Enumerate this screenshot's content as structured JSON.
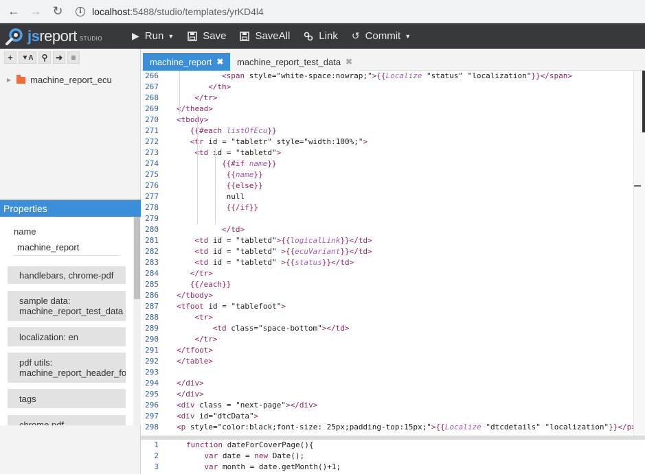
{
  "browser": {
    "url_host": "localhost",
    "url_path": ":5488/studio/templates/yrKD4l4"
  },
  "app": {
    "logo_js": "js",
    "logo_report": "report",
    "logo_studio": "STUDIO",
    "toolbar": {
      "run": "Run",
      "save": "Save",
      "save_all": "SaveAll",
      "link": "Link",
      "commit": "Commit"
    }
  },
  "tree": {
    "folder": "machine_report_ecu"
  },
  "properties": {
    "header": "Properties",
    "name_label": "name",
    "name_value": "machine_report",
    "buttons": [
      {
        "line1": "handlebars, chrome-pdf",
        "line2": ""
      },
      {
        "line1": "sample data:",
        "line2": "machine_report_test_data"
      },
      {
        "line1": "localization: en",
        "line2": ""
      },
      {
        "line1": "pdf utils:",
        "line2": "machine_report_header_footer"
      },
      {
        "line1": "tags",
        "line2": ""
      },
      {
        "line1": "chrome pdf",
        "line2": ""
      }
    ]
  },
  "tabs": [
    {
      "label": "machine_report",
      "active": true
    },
    {
      "label": "machine_report_test_data",
      "active": false
    }
  ],
  "editor_lines": [
    {
      "n": "266",
      "indent": 10,
      "tokens": [
        [
          "t-tag",
          "<span "
        ],
        [
          "t-attr",
          "style="
        ],
        [
          "t-str",
          "\"white-space:nowrap;\""
        ],
        [
          "t-tag",
          ">"
        ],
        [
          "t-hb",
          "{{"
        ],
        [
          "t-var",
          "Localize"
        ],
        [
          "t-js",
          " \"status\" \"localization\""
        ],
        [
          "t-hb",
          "}}"
        ],
        [
          "t-tag",
          "</span>"
        ]
      ]
    },
    {
      "n": "267",
      "indent": 7,
      "tokens": [
        [
          "t-tag",
          "</th>"
        ]
      ]
    },
    {
      "n": "268",
      "indent": 4,
      "tokens": [
        [
          "t-tag",
          "</tr>"
        ]
      ]
    },
    {
      "n": "269",
      "indent": 0,
      "tokens": [
        [
          "t-tag",
          "</thead>"
        ]
      ]
    },
    {
      "n": "270",
      "indent": 0,
      "tokens": [
        [
          "t-tag",
          "<tbody>"
        ]
      ]
    },
    {
      "n": "271",
      "indent": 3,
      "tokens": [
        [
          "t-hb",
          "{{#each "
        ],
        [
          "t-var",
          "listOfEcu"
        ],
        [
          "t-hb",
          "}}"
        ]
      ]
    },
    {
      "n": "272",
      "indent": 3,
      "tokens": [
        [
          "t-tag",
          "<tr "
        ],
        [
          "t-attr",
          "id = "
        ],
        [
          "t-str",
          "\"tabletr\""
        ],
        [
          "t-attr",
          " style="
        ],
        [
          "t-str",
          "\"width:100%;\""
        ],
        [
          "t-tag",
          ">"
        ]
      ]
    },
    {
      "n": "273",
      "indent": 4,
      "tokens": [
        [
          "t-tag",
          "<td "
        ],
        [
          "t-attr",
          "id = "
        ],
        [
          "t-str",
          "\"tabletd\""
        ],
        [
          "t-tag",
          ">"
        ]
      ]
    },
    {
      "n": "274",
      "indent": 10,
      "tokens": [
        [
          "t-hb",
          "{{#if "
        ],
        [
          "t-var",
          "name"
        ],
        [
          "t-hb",
          "}}"
        ]
      ]
    },
    {
      "n": "275",
      "indent": 11,
      "tokens": [
        [
          "t-hb",
          "{{"
        ],
        [
          "t-var",
          "name"
        ],
        [
          "t-hb",
          "}}"
        ]
      ]
    },
    {
      "n": "276",
      "indent": 11,
      "tokens": [
        [
          "t-hb",
          "{{else}}"
        ]
      ]
    },
    {
      "n": "277",
      "indent": 11,
      "tokens": [
        [
          "t-js",
          "null"
        ]
      ]
    },
    {
      "n": "278",
      "indent": 11,
      "tokens": [
        [
          "t-hb",
          "{{/if}}"
        ]
      ]
    },
    {
      "n": "279",
      "indent": 0,
      "tokens": []
    },
    {
      "n": "280",
      "indent": 10,
      "tokens": [
        [
          "t-tag",
          "</td>"
        ]
      ]
    },
    {
      "n": "281",
      "indent": 4,
      "tokens": [
        [
          "t-tag",
          "<td "
        ],
        [
          "t-attr",
          "id = "
        ],
        [
          "t-str",
          "\"tabletd\""
        ],
        [
          "t-tag",
          ">"
        ],
        [
          "t-hb",
          "{{"
        ],
        [
          "t-var",
          "logicalLink"
        ],
        [
          "t-hb",
          "}}"
        ],
        [
          "t-tag",
          "</td>"
        ]
      ]
    },
    {
      "n": "282",
      "indent": 4,
      "tokens": [
        [
          "t-tag",
          "<td "
        ],
        [
          "t-attr",
          "id = "
        ],
        [
          "t-str",
          "\"tabletd\" "
        ],
        [
          "t-tag",
          ">"
        ],
        [
          "t-hb",
          "{{"
        ],
        [
          "t-var",
          "ecuVariant"
        ],
        [
          "t-hb",
          "}}"
        ],
        [
          "t-tag",
          "</td>"
        ]
      ]
    },
    {
      "n": "283",
      "indent": 4,
      "tokens": [
        [
          "t-tag",
          "<td "
        ],
        [
          "t-attr",
          "id = "
        ],
        [
          "t-str",
          "\"tabletd\" "
        ],
        [
          "t-tag",
          ">"
        ],
        [
          "t-hb",
          "{{"
        ],
        [
          "t-var",
          "status"
        ],
        [
          "t-hb",
          "}}"
        ],
        [
          "t-tag",
          "</td>"
        ]
      ]
    },
    {
      "n": "284",
      "indent": 3,
      "tokens": [
        [
          "t-tag",
          "</tr>"
        ]
      ]
    },
    {
      "n": "285",
      "indent": 3,
      "tokens": [
        [
          "t-hb",
          "{{/each}}"
        ]
      ]
    },
    {
      "n": "286",
      "indent": 0,
      "tokens": [
        [
          "t-tag",
          "</tbody>"
        ]
      ]
    },
    {
      "n": "287",
      "indent": 0,
      "tokens": [
        [
          "t-tag",
          "<tfoot "
        ],
        [
          "t-attr",
          "id = "
        ],
        [
          "t-str",
          "\"tablefoot\""
        ],
        [
          "t-tag",
          ">"
        ]
      ]
    },
    {
      "n": "288",
      "indent": 4,
      "tokens": [
        [
          "t-tag",
          "<tr>"
        ]
      ]
    },
    {
      "n": "289",
      "indent": 8,
      "tokens": [
        [
          "t-tag",
          "<td "
        ],
        [
          "t-attr",
          "class="
        ],
        [
          "t-str",
          "\"space-bottom\""
        ],
        [
          "t-tag",
          "></td>"
        ]
      ]
    },
    {
      "n": "290",
      "indent": 4,
      "tokens": [
        [
          "t-tag",
          "</tr>"
        ]
      ]
    },
    {
      "n": "291",
      "indent": 0,
      "tokens": [
        [
          "t-tag",
          "</tfoot>"
        ]
      ]
    },
    {
      "n": "292",
      "indent": 0,
      "tokens": [
        [
          "t-tag",
          "</table>"
        ]
      ]
    },
    {
      "n": "293",
      "indent": 0,
      "tokens": []
    },
    {
      "n": "294",
      "indent": 0,
      "tokens": [
        [
          "t-tag",
          "</div>"
        ]
      ]
    },
    {
      "n": "295",
      "indent": 0,
      "tokens": [
        [
          "t-tag",
          "</div>"
        ]
      ]
    },
    {
      "n": "296",
      "indent": 0,
      "tokens": [
        [
          "t-tag",
          "<div "
        ],
        [
          "t-attr",
          "class = "
        ],
        [
          "t-str",
          "\"next-page\""
        ],
        [
          "t-tag",
          "></div>"
        ]
      ]
    },
    {
      "n": "297",
      "indent": 0,
      "tokens": [
        [
          "t-tag",
          "<div "
        ],
        [
          "t-attr",
          "id="
        ],
        [
          "t-str",
          "\"dtcData\""
        ],
        [
          "t-tag",
          ">"
        ]
      ]
    },
    {
      "n": "298",
      "indent": 0,
      "tokens": [
        [
          "t-tag",
          "<p "
        ],
        [
          "t-attr",
          "style="
        ],
        [
          "t-str",
          "\"color:black;font-size: 25px;padding-top:15px;\""
        ],
        [
          "t-tag",
          ">"
        ],
        [
          "t-hb",
          "{{"
        ],
        [
          "t-var",
          "Localize"
        ],
        [
          "t-js",
          " \"dtcdetails\" \"localization\""
        ],
        [
          "t-hb",
          "}}"
        ],
        [
          "t-tag",
          "</p>"
        ]
      ]
    }
  ],
  "script_lines": [
    {
      "n": "1",
      "indent": 0,
      "tokens": [
        [
          "t-kw",
          "function "
        ],
        [
          "t-js",
          "dateForCoverPage(){"
        ]
      ]
    },
    {
      "n": "2",
      "indent": 4,
      "tokens": [
        [
          "t-kw",
          "var "
        ],
        [
          "t-js",
          "date = "
        ],
        [
          "t-kw",
          "new "
        ],
        [
          "t-js",
          "Date();"
        ]
      ]
    },
    {
      "n": "3",
      "indent": 4,
      "tokens": [
        [
          "t-kw",
          "var "
        ],
        [
          "t-js",
          "month = date.getMonth()+1;"
        ]
      ]
    }
  ]
}
